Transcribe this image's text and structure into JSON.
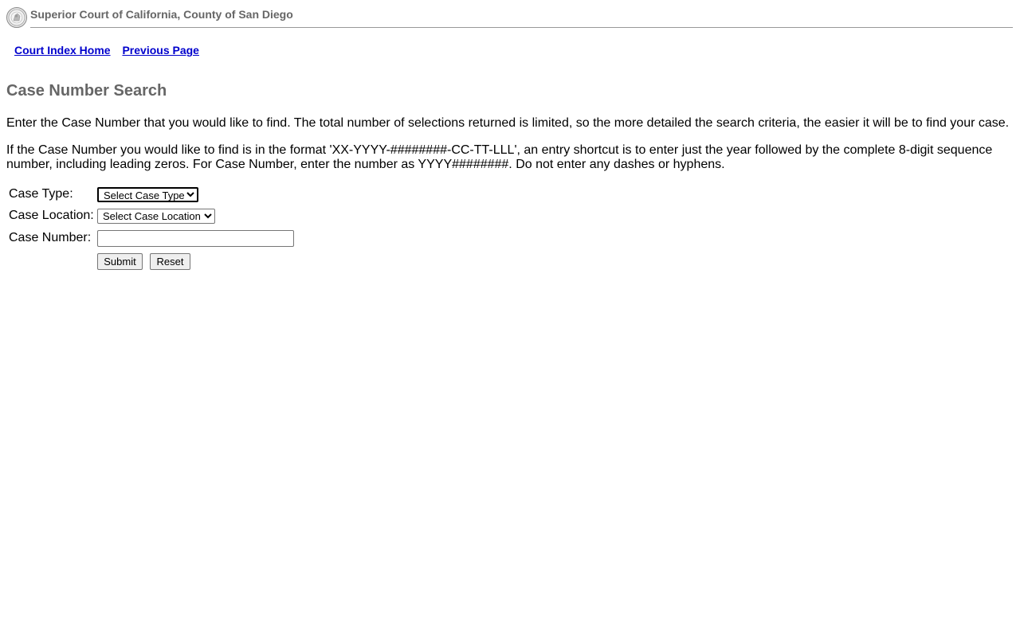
{
  "header": {
    "seal_icon": "court-seal-icon",
    "court_name": "Superior Court of California, County of San Diego"
  },
  "nav": {
    "court_index_home": "Court Index Home",
    "previous_page": "Previous Page"
  },
  "page_title": "Case Number Search",
  "instructions": {
    "paragraph_1": "Enter the Case Number that you would like to find. The total number of selections returned is limited, so the more detailed the search criteria, the easier it will be to find your case.",
    "paragraph_2": "If the Case Number you would like to find is in the format 'XX-YYYY-########-CC-TT-LLL', an entry shortcut is to enter just the year followed by the complete 8-digit sequence number, including leading zeros. For Case Number, enter the number as YYYY########. Do not enter any dashes or hyphens."
  },
  "form": {
    "case_type_label": "Case Type:",
    "case_type_selected": "Select Case Type",
    "case_location_label": "Case Location:",
    "case_location_selected": "Select Case Location",
    "case_number_label": "Case Number:",
    "case_number_value": "",
    "submit_label": "Submit",
    "reset_label": "Reset"
  },
  "colors": {
    "heading_gray": "#666666",
    "link_blue": "#0000cc"
  }
}
